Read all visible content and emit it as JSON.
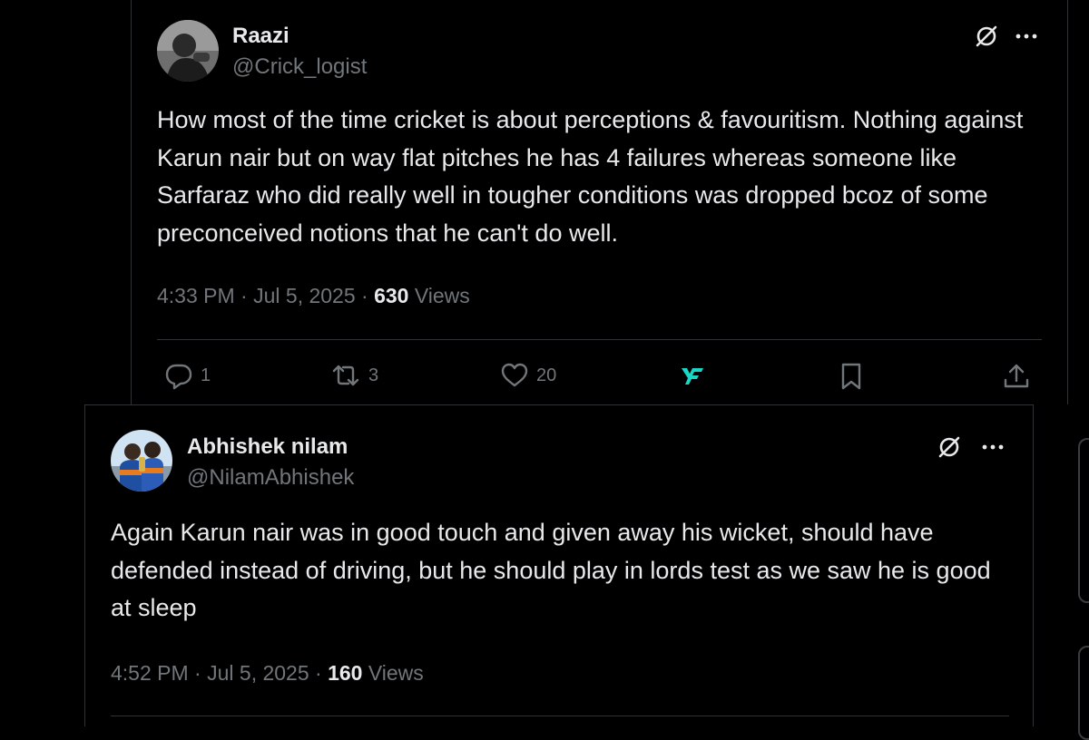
{
  "tweets": [
    {
      "author": {
        "name": "Raazi",
        "handle": "@Crick_logist"
      },
      "body": "How most of the time cricket is about perceptions & favouritism. Nothing against Karun nair but on way flat pitches he has 4 failures whereas someone like Sarfaraz who did really well in tougher conditions was dropped bcoz of some preconceived notions that he can't do well.",
      "time": "4:33 PM",
      "date": "Jul 5, 2025",
      "views": "630",
      "views_label": "Views",
      "actions": {
        "replies": "1",
        "reposts": "3",
        "likes": "20"
      },
      "icons": [
        "grok-icon",
        "more-icon",
        "reply-icon",
        "repost-icon",
        "like-icon",
        "premium-icon",
        "bookmark-icon",
        "share-icon"
      ]
    },
    {
      "author": {
        "name": "Abhishek nilam",
        "handle": "@NilamAbhishek"
      },
      "body": "Again Karun nair was in good touch and given away his wicket, should have defended instead of driving, but he should play in lords test as we saw he is good at sleep",
      "time": "4:52 PM",
      "date": "Jul 5, 2025",
      "views": "160",
      "views_label": "Views",
      "icons": [
        "grok-icon",
        "more-icon"
      ]
    }
  ],
  "separator": "·",
  "colors": {
    "background": "#000000",
    "text_primary": "#e7e9ea",
    "text_secondary": "#71767b",
    "border": "#2f3336",
    "premium_accent": "#1ad7c5"
  }
}
